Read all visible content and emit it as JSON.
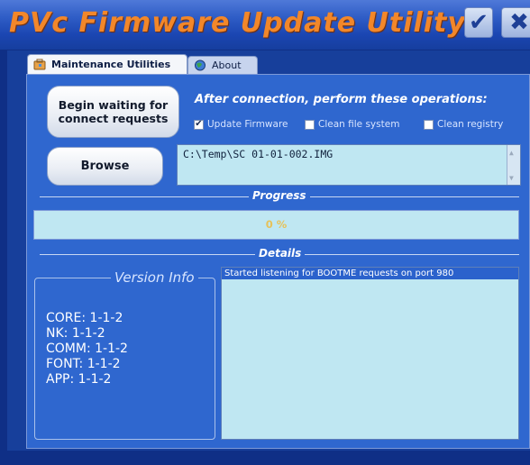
{
  "window": {
    "title": "PVc Firmware Update Utility",
    "check_glyph": "✔",
    "close_glyph": "✖"
  },
  "tabs": [
    {
      "label": "Maintenance Utilities",
      "icon": "tools-icon",
      "active": true
    },
    {
      "label": "About",
      "icon": "globe-icon",
      "active": false
    }
  ],
  "actions": {
    "wait_label_line1": "Begin waiting for",
    "wait_label_line2": "connect requests",
    "browse_label": "Browse"
  },
  "operations": {
    "title": "After connection, perform these operations:",
    "items": [
      {
        "label": "Update Firmware",
        "checked": true
      },
      {
        "label": "Clean file system",
        "checked": false
      },
      {
        "label": "Clean registry",
        "checked": false
      }
    ]
  },
  "file": {
    "path": "C:\\Temp\\SC 01-01-002.IMG"
  },
  "progress": {
    "label": "Progress",
    "percent_text": "0 %",
    "value_percent": 0
  },
  "details": {
    "label": "Details",
    "lines": [
      "Started listening for BOOTME requests on port 980"
    ]
  },
  "version_info": {
    "title": "Version Info",
    "lines": [
      "CORE: 1-1-2",
      "NK: 1-1-2",
      "COMM: 1-1-2",
      "FONT: 1-1-2",
      "APP: 1-1-2"
    ]
  },
  "colors": {
    "title_orange": "#f2872a",
    "panel_blue": "#2f67cf",
    "field_cyan": "#bfe7f2",
    "progress_text": "#e6c25a"
  }
}
